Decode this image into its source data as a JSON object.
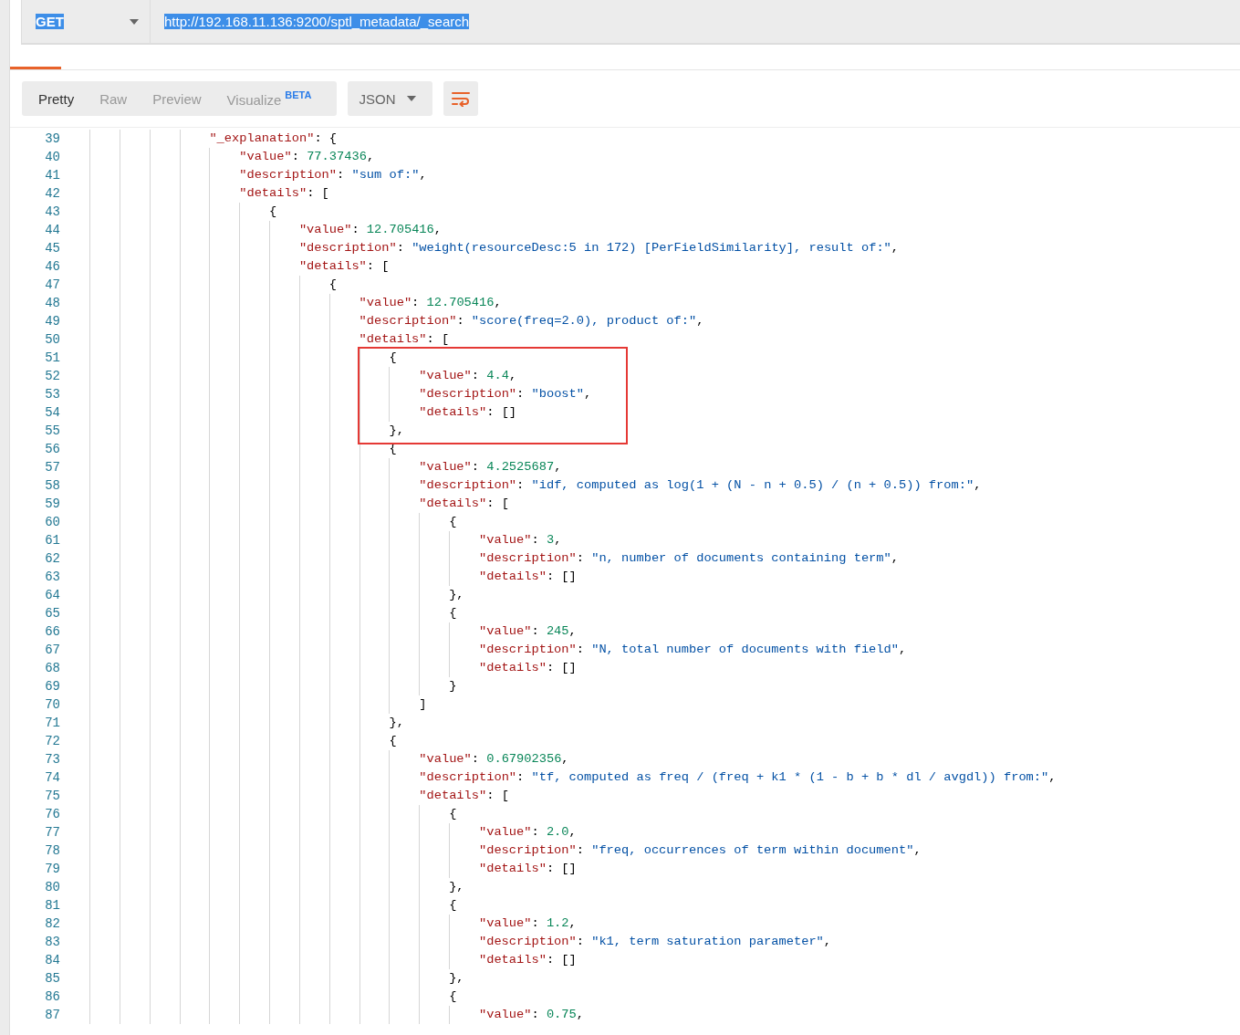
{
  "request": {
    "method": {
      "value": "GET",
      "highlighted": true
    },
    "url": {
      "value": "http://192.168.11.136:9200/sptl_metadata/_search",
      "highlighted": true
    }
  },
  "response_toolbar": {
    "view_tabs": [
      {
        "label": "Pretty",
        "selected": true
      },
      {
        "label": "Raw",
        "selected": false
      },
      {
        "label": "Preview",
        "selected": false
      },
      {
        "label": "Visualize",
        "badge": "BETA",
        "selected": false
      }
    ],
    "format": "JSON"
  },
  "annotation": {
    "kind": "rectangle"
  },
  "code_lines": [
    {
      "number": "39",
      "tokens": [
        {
          "kind": "key",
          "text": "\"_explanation\""
        },
        {
          "kind": "punct",
          "text": ": {"
        }
      ],
      "children": [
        {
          "number": "40",
          "tokens": [
            {
              "kind": "key",
              "text": "\"value\""
            },
            {
              "kind": "punct",
              "text": ": "
            },
            {
              "kind": "number",
              "text": "77.37436"
            },
            {
              "kind": "punct",
              "text": ","
            }
          ]
        },
        {
          "number": "41",
          "tokens": [
            {
              "kind": "key",
              "text": "\"description\""
            },
            {
              "kind": "punct",
              "text": ": "
            },
            {
              "kind": "string",
              "text": "\"sum of:\""
            },
            {
              "kind": "punct",
              "text": ","
            }
          ]
        },
        {
          "number": "42",
          "tokens": [
            {
              "kind": "key",
              "text": "\"details\""
            },
            {
              "kind": "punct",
              "text": ": ["
            }
          ],
          "children": [
            {
              "number": "43",
              "tokens": [
                {
                  "kind": "punct",
                  "text": "{"
                }
              ],
              "children": [
                {
                  "number": "44",
                  "tokens": [
                    {
                      "kind": "key",
                      "text": "\"value\""
                    },
                    {
                      "kind": "punct",
                      "text": ": "
                    },
                    {
                      "kind": "number",
                      "text": "12.705416"
                    },
                    {
                      "kind": "punct",
                      "text": ","
                    }
                  ]
                },
                {
                  "number": "45",
                  "tokens": [
                    {
                      "kind": "key",
                      "text": "\"description\""
                    },
                    {
                      "kind": "punct",
                      "text": ": "
                    },
                    {
                      "kind": "string",
                      "text": "\"weight(resourceDesc:5 in 172) [PerFieldSimilarity], result of:\""
                    },
                    {
                      "kind": "punct",
                      "text": ","
                    }
                  ]
                },
                {
                  "number": "46",
                  "tokens": [
                    {
                      "kind": "key",
                      "text": "\"details\""
                    },
                    {
                      "kind": "punct",
                      "text": ": ["
                    }
                  ],
                  "children": [
                    {
                      "number": "47",
                      "tokens": [
                        {
                          "kind": "punct",
                          "text": "{"
                        }
                      ],
                      "children": [
                        {
                          "number": "48",
                          "tokens": [
                            {
                              "kind": "key",
                              "text": "\"value\""
                            },
                            {
                              "kind": "punct",
                              "text": ": "
                            },
                            {
                              "kind": "number",
                              "text": "12.705416"
                            },
                            {
                              "kind": "punct",
                              "text": ","
                            }
                          ]
                        },
                        {
                          "number": "49",
                          "tokens": [
                            {
                              "kind": "key",
                              "text": "\"description\""
                            },
                            {
                              "kind": "punct",
                              "text": ": "
                            },
                            {
                              "kind": "string",
                              "text": "\"score(freq=2.0), product of:\""
                            },
                            {
                              "kind": "punct",
                              "text": ","
                            }
                          ]
                        },
                        {
                          "number": "50",
                          "tokens": [
                            {
                              "kind": "key",
                              "text": "\"details\""
                            },
                            {
                              "kind": "punct",
                              "text": ": ["
                            }
                          ],
                          "children": [
                            {
                              "number": "51",
                              "tokens": [
                                {
                                  "kind": "punct",
                                  "text": "{"
                                }
                              ],
                              "children": [
                                {
                                  "number": "52",
                                  "tokens": [
                                    {
                                      "kind": "key",
                                      "text": "\"value\""
                                    },
                                    {
                                      "kind": "punct",
                                      "text": ": "
                                    },
                                    {
                                      "kind": "number",
                                      "text": "4.4"
                                    },
                                    {
                                      "kind": "punct",
                                      "text": ","
                                    }
                                  ]
                                },
                                {
                                  "number": "53",
                                  "tokens": [
                                    {
                                      "kind": "key",
                                      "text": "\"description\""
                                    },
                                    {
                                      "kind": "punct",
                                      "text": ": "
                                    },
                                    {
                                      "kind": "string",
                                      "text": "\"boost\""
                                    },
                                    {
                                      "kind": "punct",
                                      "text": ","
                                    }
                                  ]
                                },
                                {
                                  "number": "54",
                                  "tokens": [
                                    {
                                      "kind": "key",
                                      "text": "\"details\""
                                    },
                                    {
                                      "kind": "punct",
                                      "text": ": []"
                                    }
                                  ]
                                }
                              ]
                            },
                            {
                              "number": "55",
                              "tokens": [
                                {
                                  "kind": "punct",
                                  "text": "},"
                                }
                              ]
                            },
                            {
                              "number": "56",
                              "tokens": [
                                {
                                  "kind": "punct",
                                  "text": "{"
                                }
                              ],
                              "children": [
                                {
                                  "number": "57",
                                  "tokens": [
                                    {
                                      "kind": "key",
                                      "text": "\"value\""
                                    },
                                    {
                                      "kind": "punct",
                                      "text": ": "
                                    },
                                    {
                                      "kind": "number",
                                      "text": "4.2525687"
                                    },
                                    {
                                      "kind": "punct",
                                      "text": ","
                                    }
                                  ]
                                },
                                {
                                  "number": "58",
                                  "tokens": [
                                    {
                                      "kind": "key",
                                      "text": "\"description\""
                                    },
                                    {
                                      "kind": "punct",
                                      "text": ": "
                                    },
                                    {
                                      "kind": "string",
                                      "text": "\"idf, computed as log(1 + (N - n + 0.5) / (n + 0.5)) from:\""
                                    },
                                    {
                                      "kind": "punct",
                                      "text": ","
                                    }
                                  ]
                                },
                                {
                                  "number": "59",
                                  "tokens": [
                                    {
                                      "kind": "key",
                                      "text": "\"details\""
                                    },
                                    {
                                      "kind": "punct",
                                      "text": ": ["
                                    }
                                  ],
                                  "children": [
                                    {
                                      "number": "60",
                                      "tokens": [
                                        {
                                          "kind": "punct",
                                          "text": "{"
                                        }
                                      ],
                                      "children": [
                                        {
                                          "number": "61",
                                          "tokens": [
                                            {
                                              "kind": "key",
                                              "text": "\"value\""
                                            },
                                            {
                                              "kind": "punct",
                                              "text": ": "
                                            },
                                            {
                                              "kind": "number",
                                              "text": "3"
                                            },
                                            {
                                              "kind": "punct",
                                              "text": ","
                                            }
                                          ]
                                        },
                                        {
                                          "number": "62",
                                          "tokens": [
                                            {
                                              "kind": "key",
                                              "text": "\"description\""
                                            },
                                            {
                                              "kind": "punct",
                                              "text": ": "
                                            },
                                            {
                                              "kind": "string",
                                              "text": "\"n, number of documents containing term\""
                                            },
                                            {
                                              "kind": "punct",
                                              "text": ","
                                            }
                                          ]
                                        },
                                        {
                                          "number": "63",
                                          "tokens": [
                                            {
                                              "kind": "key",
                                              "text": "\"details\""
                                            },
                                            {
                                              "kind": "punct",
                                              "text": ": []"
                                            }
                                          ]
                                        }
                                      ]
                                    },
                                    {
                                      "number": "64",
                                      "tokens": [
                                        {
                                          "kind": "punct",
                                          "text": "},"
                                        }
                                      ]
                                    },
                                    {
                                      "number": "65",
                                      "tokens": [
                                        {
                                          "kind": "punct",
                                          "text": "{"
                                        }
                                      ],
                                      "children": [
                                        {
                                          "number": "66",
                                          "tokens": [
                                            {
                                              "kind": "key",
                                              "text": "\"value\""
                                            },
                                            {
                                              "kind": "punct",
                                              "text": ": "
                                            },
                                            {
                                              "kind": "number",
                                              "text": "245"
                                            },
                                            {
                                              "kind": "punct",
                                              "text": ","
                                            }
                                          ]
                                        },
                                        {
                                          "number": "67",
                                          "tokens": [
                                            {
                                              "kind": "key",
                                              "text": "\"description\""
                                            },
                                            {
                                              "kind": "punct",
                                              "text": ": "
                                            },
                                            {
                                              "kind": "string",
                                              "text": "\"N, total number of documents with field\""
                                            },
                                            {
                                              "kind": "punct",
                                              "text": ","
                                            }
                                          ]
                                        },
                                        {
                                          "number": "68",
                                          "tokens": [
                                            {
                                              "kind": "key",
                                              "text": "\"details\""
                                            },
                                            {
                                              "kind": "punct",
                                              "text": ": []"
                                            }
                                          ]
                                        }
                                      ]
                                    },
                                    {
                                      "number": "69",
                                      "tokens": [
                                        {
                                          "kind": "punct",
                                          "text": "}"
                                        }
                                      ]
                                    }
                                  ]
                                },
                                {
                                  "number": "70",
                                  "tokens": [
                                    {
                                      "kind": "punct",
                                      "text": "]"
                                    }
                                  ]
                                }
                              ]
                            },
                            {
                              "number": "71",
                              "tokens": [
                                {
                                  "kind": "punct",
                                  "text": "},"
                                }
                              ]
                            },
                            {
                              "number": "72",
                              "tokens": [
                                {
                                  "kind": "punct",
                                  "text": "{"
                                }
                              ],
                              "children": [
                                {
                                  "number": "73",
                                  "tokens": [
                                    {
                                      "kind": "key",
                                      "text": "\"value\""
                                    },
                                    {
                                      "kind": "punct",
                                      "text": ": "
                                    },
                                    {
                                      "kind": "number",
                                      "text": "0.67902356"
                                    },
                                    {
                                      "kind": "punct",
                                      "text": ","
                                    }
                                  ]
                                },
                                {
                                  "number": "74",
                                  "tokens": [
                                    {
                                      "kind": "key",
                                      "text": "\"description\""
                                    },
                                    {
                                      "kind": "punct",
                                      "text": ": "
                                    },
                                    {
                                      "kind": "string",
                                      "text": "\"tf, computed as freq / (freq + k1 * (1 - b + b * dl / avgdl)) from:\""
                                    },
                                    {
                                      "kind": "punct",
                                      "text": ","
                                    }
                                  ]
                                },
                                {
                                  "number": "75",
                                  "tokens": [
                                    {
                                      "kind": "key",
                                      "text": "\"details\""
                                    },
                                    {
                                      "kind": "punct",
                                      "text": ": ["
                                    }
                                  ],
                                  "children": [
                                    {
                                      "number": "76",
                                      "tokens": [
                                        {
                                          "kind": "punct",
                                          "text": "{"
                                        }
                                      ],
                                      "children": [
                                        {
                                          "number": "77",
                                          "tokens": [
                                            {
                                              "kind": "key",
                                              "text": "\"value\""
                                            },
                                            {
                                              "kind": "punct",
                                              "text": ": "
                                            },
                                            {
                                              "kind": "number",
                                              "text": "2.0"
                                            },
                                            {
                                              "kind": "punct",
                                              "text": ","
                                            }
                                          ]
                                        },
                                        {
                                          "number": "78",
                                          "tokens": [
                                            {
                                              "kind": "key",
                                              "text": "\"description\""
                                            },
                                            {
                                              "kind": "punct",
                                              "text": ": "
                                            },
                                            {
                                              "kind": "string",
                                              "text": "\"freq, occurrences of term within document\""
                                            },
                                            {
                                              "kind": "punct",
                                              "text": ","
                                            }
                                          ]
                                        },
                                        {
                                          "number": "79",
                                          "tokens": [
                                            {
                                              "kind": "key",
                                              "text": "\"details\""
                                            },
                                            {
                                              "kind": "punct",
                                              "text": ": []"
                                            }
                                          ]
                                        }
                                      ]
                                    },
                                    {
                                      "number": "80",
                                      "tokens": [
                                        {
                                          "kind": "punct",
                                          "text": "},"
                                        }
                                      ]
                                    },
                                    {
                                      "number": "81",
                                      "tokens": [
                                        {
                                          "kind": "punct",
                                          "text": "{"
                                        }
                                      ],
                                      "children": [
                                        {
                                          "number": "82",
                                          "tokens": [
                                            {
                                              "kind": "key",
                                              "text": "\"value\""
                                            },
                                            {
                                              "kind": "punct",
                                              "text": ": "
                                            },
                                            {
                                              "kind": "number",
                                              "text": "1.2"
                                            },
                                            {
                                              "kind": "punct",
                                              "text": ","
                                            }
                                          ]
                                        },
                                        {
                                          "number": "83",
                                          "tokens": [
                                            {
                                              "kind": "key",
                                              "text": "\"description\""
                                            },
                                            {
                                              "kind": "punct",
                                              "text": ": "
                                            },
                                            {
                                              "kind": "string",
                                              "text": "\"k1, term saturation parameter\""
                                            },
                                            {
                                              "kind": "punct",
                                              "text": ","
                                            }
                                          ]
                                        },
                                        {
                                          "number": "84",
                                          "tokens": [
                                            {
                                              "kind": "key",
                                              "text": "\"details\""
                                            },
                                            {
                                              "kind": "punct",
                                              "text": ": []"
                                            }
                                          ]
                                        }
                                      ]
                                    },
                                    {
                                      "number": "85",
                                      "tokens": [
                                        {
                                          "kind": "punct",
                                          "text": "},"
                                        }
                                      ]
                                    },
                                    {
                                      "number": "86",
                                      "tokens": [
                                        {
                                          "kind": "punct",
                                          "text": "{"
                                        }
                                      ],
                                      "children": [
                                        {
                                          "number": "87",
                                          "tokens": [
                                            {
                                              "kind": "key",
                                              "text": "\"value\""
                                            },
                                            {
                                              "kind": "punct",
                                              "text": ": "
                                            },
                                            {
                                              "kind": "number",
                                              "text": "0.75"
                                            },
                                            {
                                              "kind": "punct",
                                              "text": ","
                                            }
                                          ]
                                        }
                                      ]
                                    }
                                  ]
                                }
                              ]
                            }
                          ]
                        }
                      ]
                    }
                  ]
                }
              ]
            }
          ]
        }
      ]
    }
  ]
}
